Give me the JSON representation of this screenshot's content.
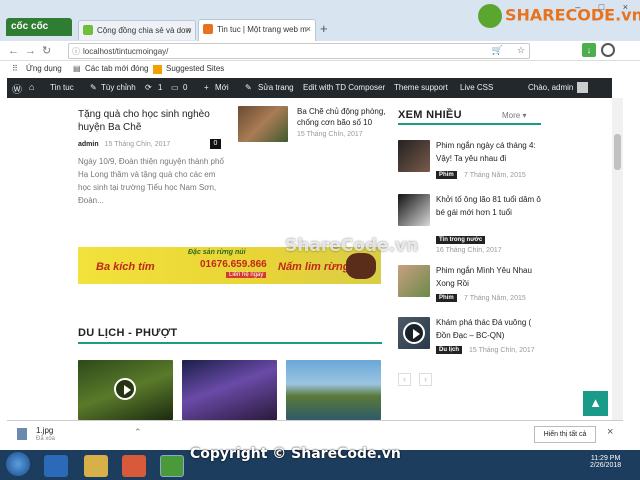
{
  "browser": {
    "logo_text": "cốc cốc",
    "tabs": [
      {
        "label": "Cộng đồng chia sẻ và dow"
      },
      {
        "label": "Tin tuc | Một trang web m"
      }
    ],
    "new_tab": "+",
    "url": "localhost/tintucmoingay/",
    "window_controls": "– □ ×"
  },
  "sharecode_logo": "SHARECODE.vn",
  "bookmarks": {
    "apps": "Ứng dụng",
    "new_tab": "Các tab mới đóng",
    "suggested": "Suggested Sites"
  },
  "wp_admin_bar": {
    "site": "Tin tuc",
    "customize": "Tùy chỉnh",
    "updates": "1",
    "comments": "0",
    "new": "Mới",
    "edit": "Sửa trang",
    "composer": "Edit with TD Composer",
    "theme_support": "Theme support",
    "live_css": "Live CSS",
    "greeting": "Chào, admin"
  },
  "main": {
    "article": {
      "title": "Tặng quà cho học sinh nghèo huyện Ba Chẽ",
      "author": "admin",
      "date": "15 Tháng Chín, 2017",
      "comments": "0",
      "excerpt": "Ngày 10/9, Đoàn thiện nguyện thành phố Hạ Long thăm và tặng quà cho các em học sinh tại trường Tiểu học Nam Sơn, Đoàn..."
    },
    "side_article": {
      "title": "Ba Chẽ chủ động phòng, chống cơn bão số 10",
      "date": "15 Tháng Chín, 2017"
    },
    "banner": {
      "top": "Đặc sản rừng núi",
      "left": "Ba kích tím",
      "phone": "01676.659.866",
      "cta": "Liên hệ ngay",
      "right": "Nấm lim rừng"
    },
    "section_title": "DU LỊCH - PHƯỢT"
  },
  "sidebar": {
    "title": "XEM NHIỀU",
    "more": "More",
    "items": [
      {
        "title": "Phim ngắn ngày cá tháng 4: Vậy! Ta yêu nhau đi",
        "badge": "Phim",
        "date": "7 Tháng Năm, 2015"
      },
      {
        "title": "Khởi tố ông lão 81 tuổi dâm ô bé gái mới hơn 1 tuổi",
        "badge": "Tin trong nước",
        "date": "16 Tháng Chín, 2017"
      },
      {
        "title": "Phim ngắn Mình Yêu Nhau Xong Rồi",
        "badge": "Phim",
        "date": "7 Tháng Năm, 2015"
      },
      {
        "title": "Khám phá thác Đá vuông ( Đồn Đạc – BC-QN)",
        "badge": "Du lịch",
        "date": "15 Tháng Chín, 2017"
      }
    ],
    "prev": "‹",
    "next": "›"
  },
  "scroll_top": "▲",
  "downloads": {
    "file": "1.jpg",
    "status": "Đã xóa",
    "show_all": "Hiển thị tất cả",
    "close": "×"
  },
  "taskbar": {
    "time": "11:29 PM",
    "date": "2/26/2018"
  },
  "watermark": "Copyright © ShareCode.vn",
  "overlay_watermark": "ShareCode.vn",
  "colors": {
    "accent": "#1a9b8a",
    "wp_bar": "#23282d",
    "brand_green": "#2f7d32",
    "taskbar": "#1d3d5e"
  }
}
